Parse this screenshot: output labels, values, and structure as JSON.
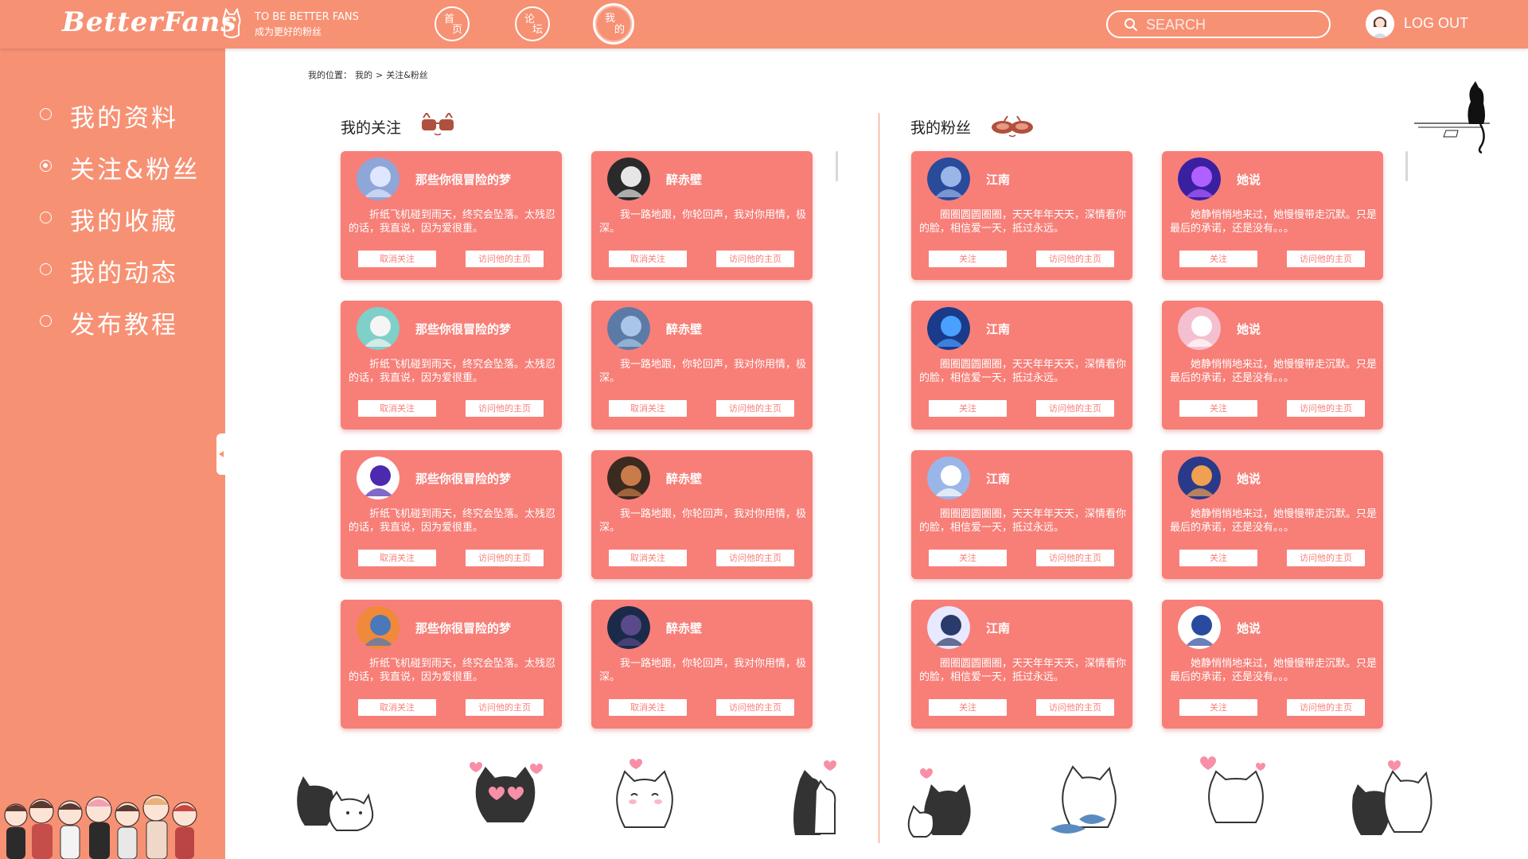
{
  "header": {
    "logo": "BetterFans",
    "slogan": "TO BE BETTER FANS",
    "slogan_cn": "成为更好的粉丝",
    "nav": [
      {
        "c1": "首",
        "c2": "页"
      },
      {
        "c1": "论",
        "c2": "坛"
      },
      {
        "c1": "我",
        "c2": "的"
      }
    ],
    "search_placeholder": "SEARCH",
    "logout": "LOG OUT"
  },
  "sidebar": {
    "items": [
      {
        "label": "我的资料"
      },
      {
        "label": "关注&粉丝"
      },
      {
        "label": "我的收藏"
      },
      {
        "label": "我的动态"
      },
      {
        "label": "发布教程"
      }
    ]
  },
  "breadcrumb": {
    "prefix": "我的位置：",
    "level1": "我的",
    "sep": ">",
    "level2": "关注&粉丝"
  },
  "following": {
    "title": "我的关注",
    "cards": [
      {
        "name": "那些你很冒险的梦",
        "desc": "折纸飞机碰到雨天，终究会坠落。太残忍的话，我直说，因为爱很重。",
        "btn1": "取消关注",
        "btn2": "访问他的主页"
      },
      {
        "name": "醉赤壁",
        "desc": "我一路地跟，你轮回声，我对你用情，极深。",
        "btn1": "取消关注",
        "btn2": "访问他的主页"
      },
      {
        "name": "那些你很冒险的梦",
        "desc": "折纸飞机碰到雨天，终究会坠落。太残忍的话，我直说，因为爱很重。",
        "btn1": "取消关注",
        "btn2": "访问他的主页"
      },
      {
        "name": "醉赤壁",
        "desc": "我一路地跟，你轮回声，我对你用情，极深。",
        "btn1": "取消关注",
        "btn2": "访问他的主页"
      },
      {
        "name": "那些你很冒险的梦",
        "desc": "折纸飞机碰到雨天，终究会坠落。太残忍的话，我直说，因为爱很重。",
        "btn1": "取消关注",
        "btn2": "访问他的主页"
      },
      {
        "name": "醉赤壁",
        "desc": "我一路地跟，你轮回声，我对你用情，极深。",
        "btn1": "取消关注",
        "btn2": "访问他的主页"
      },
      {
        "name": "那些你很冒险的梦",
        "desc": "折纸飞机碰到雨天，终究会坠落。太残忍的话，我直说，因为爱很重。",
        "btn1": "取消关注",
        "btn2": "访问他的主页"
      },
      {
        "name": "醉赤壁",
        "desc": "我一路地跟，你轮回声，我对你用情，极深。",
        "btn1": "取消关注",
        "btn2": "访问他的主页"
      }
    ]
  },
  "fans": {
    "title": "我的粉丝",
    "cards": [
      {
        "name": "江南",
        "desc": "圈圈圆圆圈圈，天天年年天天，深情看你的脸，相信爱一天，抵过永远。",
        "btn1": "关注",
        "btn2": "访问他的主页"
      },
      {
        "name": "她说",
        "desc": "她静悄悄地来过，她慢慢带走沉默。只是最后的承诺，还是没有。。。",
        "btn1": "关注",
        "btn2": "访问他的主页"
      },
      {
        "name": "江南",
        "desc": "圈圈圆圆圈圈，天天年年天天，深情看你的脸，相信爱一天，抵过永远。",
        "btn1": "关注",
        "btn2": "访问他的主页"
      },
      {
        "name": "她说",
        "desc": "她静悄悄地来过，她慢慢带走沉默。只是最后的承诺，还是没有。。。",
        "btn1": "关注",
        "btn2": "访问他的主页"
      },
      {
        "name": "江南",
        "desc": "圈圈圆圆圈圈，天天年年天天，深情看你的脸，相信爱一天，抵过永远。",
        "btn1": "关注",
        "btn2": "访问他的主页"
      },
      {
        "name": "她说",
        "desc": "她静悄悄地来过，她慢慢带走沉默。只是最后的承诺，还是没有。。。",
        "btn1": "关注",
        "btn2": "访问他的主页"
      },
      {
        "name": "江南",
        "desc": "圈圈圆圆圈圈，天天年年天天，深情看你的脸，相信爱一天，抵过永远。",
        "btn1": "关注",
        "btn2": "访问他的主页"
      },
      {
        "name": "她说",
        "desc": "她静悄悄地来过，她慢慢带走沉默。只是最后的承诺，还是没有。。。",
        "btn1": "关注",
        "btn2": "访问他的主页"
      }
    ]
  },
  "colors": {
    "primary": "#f79174",
    "card": "#f77f78",
    "text_dark": "#222222"
  }
}
